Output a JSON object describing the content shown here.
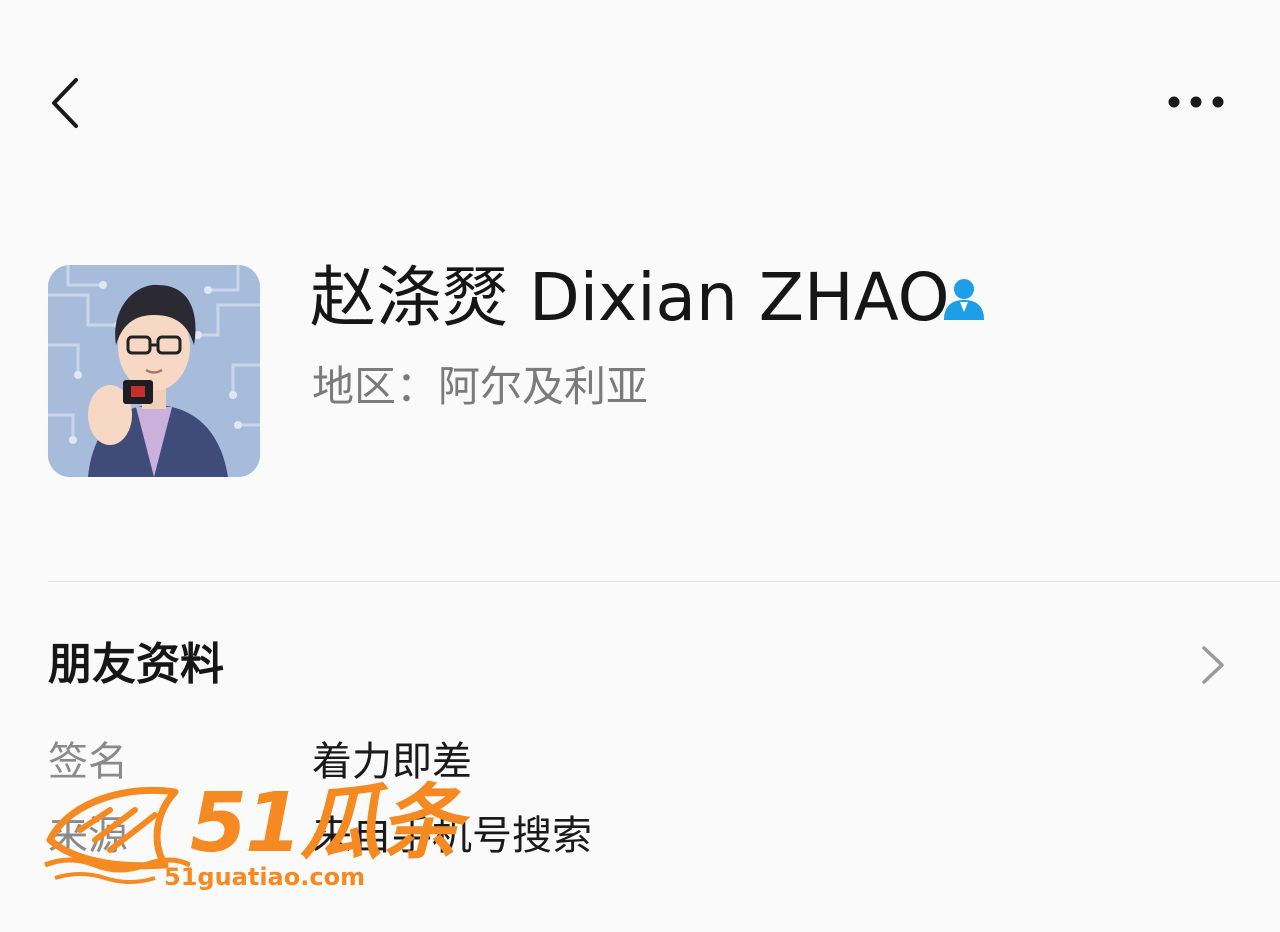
{
  "profile": {
    "name": "赵涤燹 Dixian ZHAO",
    "region": "地区：阿尔及利亚"
  },
  "icons": {
    "back": "chevron-left-icon",
    "more": "more-horizontal-icon",
    "contact": "person-icon",
    "chevron": "chevron-right-icon"
  },
  "colors": {
    "contact_icon": "#1e9ee6",
    "watermark": "#f58a22"
  },
  "friend_info": {
    "title": "朋友资料",
    "rows": [
      {
        "label": "签名",
        "value": "着力即差"
      },
      {
        "label": "来源",
        "value": "来自手机号搜索"
      }
    ]
  },
  "watermark": {
    "logo_text": "51瓜条",
    "url": "51guatiao.com"
  }
}
